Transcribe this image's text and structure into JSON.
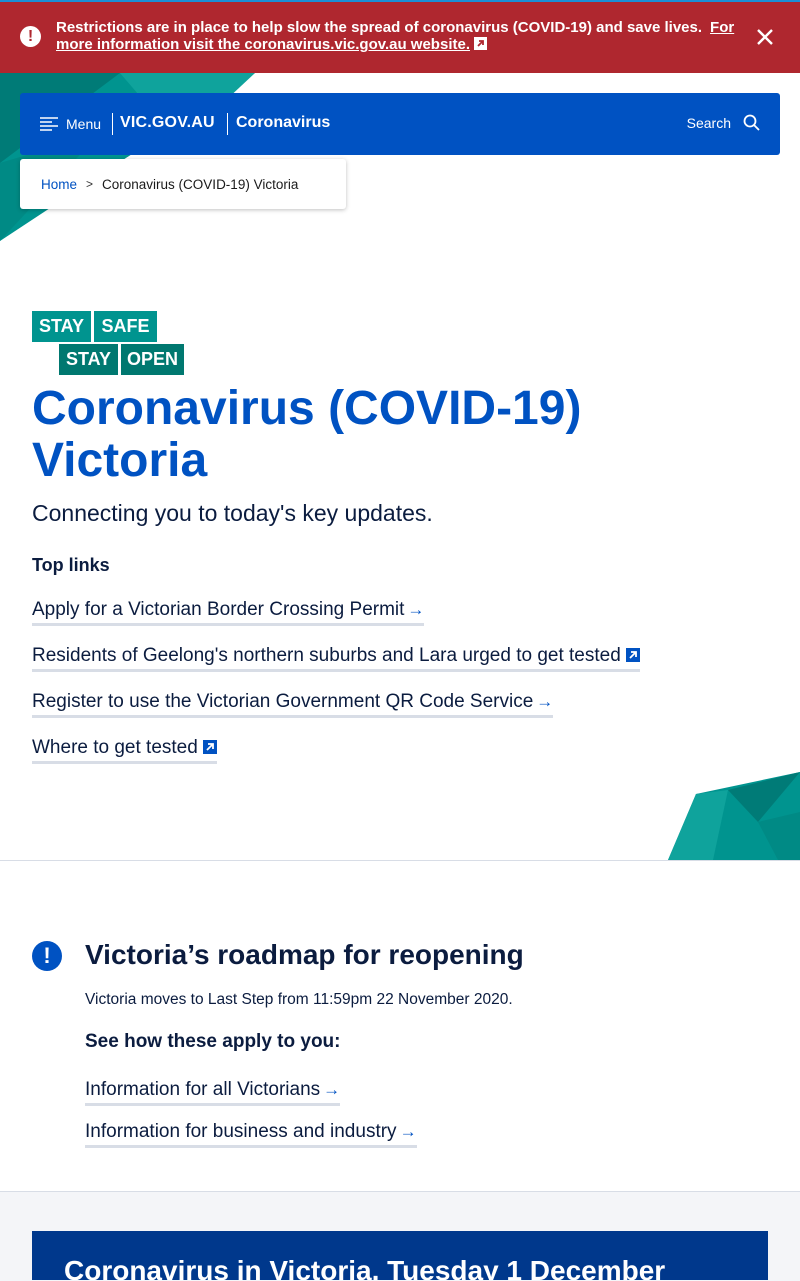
{
  "alert": {
    "message": "Restrictions are in place to help slow the spread of coronavirus (COVID-19) and save lives.",
    "link": "For more information visit the coronavirus.vic.gov.au website.",
    "icon": "exclamation-icon",
    "close_icon": "close-icon"
  },
  "header": {
    "menu_label": "Menu",
    "logo": "VIC.GOV.AU",
    "site_name": "Coronavirus",
    "search_label": "Search"
  },
  "breadcrumb": {
    "home": "Home",
    "separator": ">",
    "current": "Coronavirus (COVID-19) Victoria"
  },
  "stay_logo": {
    "word1": "STAY",
    "word2": "SAFE",
    "word3": "STAY",
    "word4": "OPEN"
  },
  "page": {
    "title": "Coronavirus (COVID-19) Victoria",
    "intro": "Connecting you to today's key updates.",
    "top_links_heading": "Top links",
    "top_links": [
      {
        "label": "Apply for a Victorian Border Crossing Permit",
        "icon": "arrow-right-icon"
      },
      {
        "label": "Residents of Geelong's northern suburbs and Lara urged to get tested",
        "icon": "external-link-icon"
      },
      {
        "label": "Register to use the Victorian Government QR Code Service",
        "icon": "arrow-right-icon"
      },
      {
        "label": "Where to get tested",
        "icon": "external-link-icon"
      }
    ]
  },
  "roadmap": {
    "title": "Victoria’s roadmap for reopening",
    "text": "Victoria moves to Last Step from 11:59pm 22 November 2020.",
    "subheading": "See how these apply to you:",
    "links": [
      {
        "label": "Information for all Victorians"
      },
      {
        "label": "Information for business and industry"
      }
    ]
  },
  "update": {
    "title": "Coronavirus in Victoria, Tuesday 1 December"
  },
  "colors": {
    "alert_red": "#af272f",
    "brand_blue": "#0052c2",
    "teal": "#00948f",
    "navy": "#0b1c3f"
  }
}
